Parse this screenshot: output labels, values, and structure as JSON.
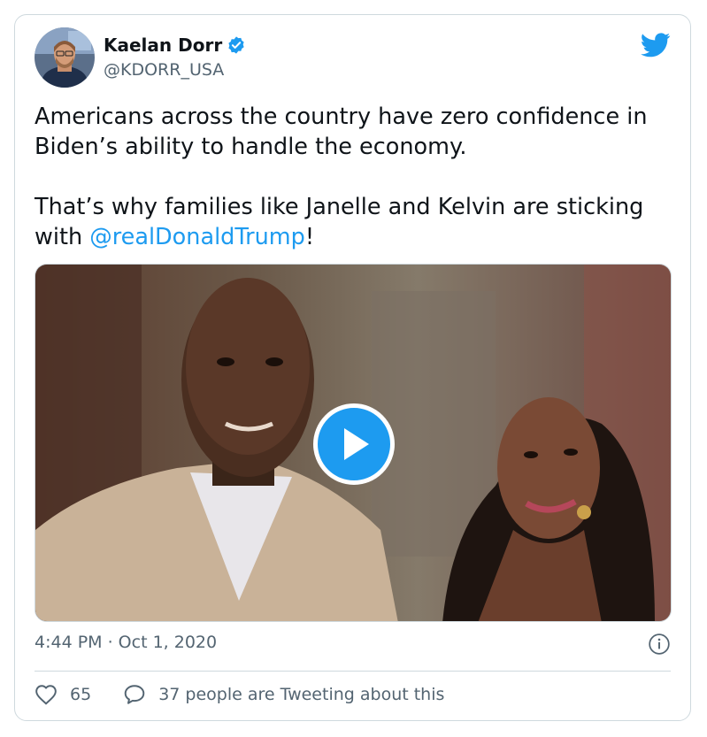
{
  "user": {
    "name": "Kaelan Dorr",
    "handle": "@KDORR_USA",
    "verified": true
  },
  "tweet": {
    "text_before_mention": "Americans across the country have zero confidence in Biden’s ability to handle the economy.\n\nThat’s why families like Janelle and Kelvin are sticking with ",
    "mention": "@realDonaldTrump",
    "text_after_mention": "!",
    "timestamp": "4:44 PM · Oct 1, 2020"
  },
  "engagement": {
    "likes": "65",
    "conversation_label": "37 people are Tweeting about this"
  },
  "icons": {
    "brand": "twitter-bird-icon",
    "verified": "verified-badge-icon",
    "play": "play-icon",
    "info": "info-icon",
    "like": "heart-icon",
    "reply": "speech-bubble-icon"
  },
  "colors": {
    "accent": "#1d9bf0",
    "text": "#0f1419",
    "secondary": "#536471",
    "border": "#cfd9de"
  }
}
